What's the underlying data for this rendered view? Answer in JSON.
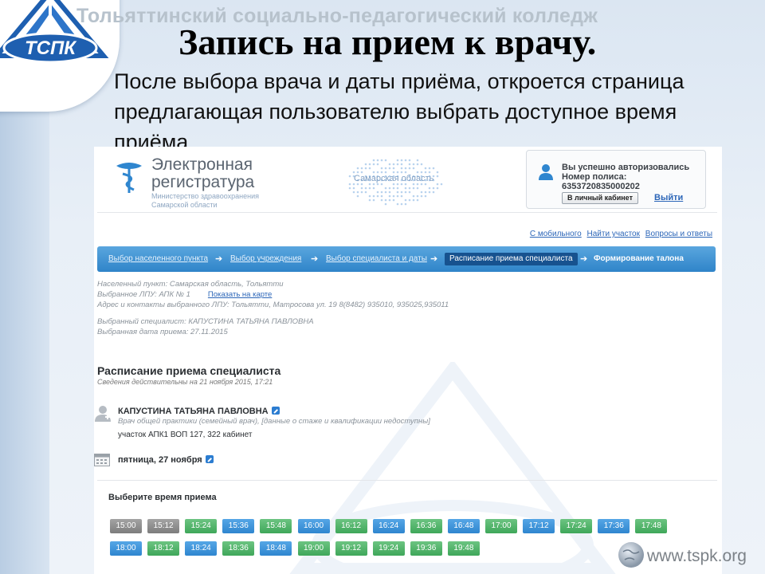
{
  "slide": {
    "college_name": "Тольяттинский социально-педагогический колледж",
    "logo_text": "ТСПК",
    "title": "Запись на прием к врачу.",
    "body": "После выбора врача и даты приёма, откроется страница предлагающая пользователю выбрать доступное время приёма",
    "footer_url": "www.tspk.org"
  },
  "site": {
    "name_line1": "Электронная",
    "name_line2": "регистратура",
    "ministry_line1": "Министерство здравоохранения",
    "ministry_line2": "Самарской области",
    "region": "Самарская область",
    "auth": {
      "status": "Вы успешно авторизовались",
      "policy_label": "Номер полиса:",
      "policy_number": "6353720835000202",
      "cabinet_button": "В личный кабинет",
      "logout": "Выйти"
    },
    "quick_links": [
      "С мобильного",
      "Найти участок",
      "Вопросы и ответы"
    ],
    "steps": [
      {
        "label": "Выбор населенного пункта",
        "state": "done"
      },
      {
        "label": "Выбор учреждения",
        "state": "done"
      },
      {
        "label": "Выбор специалиста и даты",
        "state": "done"
      },
      {
        "label": "Расписание приема специалиста",
        "state": "active"
      },
      {
        "label": "Формирование талона",
        "state": "next"
      }
    ],
    "info": {
      "settlement": "Населенный пункт: Самарская область, Тольятти",
      "lpu": "Выбранное ЛПУ: АПК № 1",
      "map_link": "Показать на карте",
      "address": "Адрес и контакты выбранного ЛПУ: Тольятти, Матросова ул. 19 8(8482) 935010, 935025,935011",
      "specialist": "Выбранный специалист: КАПУСТИНА ТАТЬЯНА ПАВЛОВНА",
      "date": "Выбранная дата приема: 27.11.2015"
    },
    "schedule": {
      "title": "Расписание приема специалиста",
      "subtitle": "Сведения действительны на 21 ноября 2015, 17:21",
      "doctor_name": "КАПУСТИНА ТАТЬЯНА ПАВЛОВНА",
      "doctor_spec": "Врач общей практики (семейный врач), [данные о стаже и квалификации недоступны]",
      "doctor_site": "участок АПК1 ВОП 127, 322 кабинет",
      "day": "пятница, 27 ноября",
      "pick_label": "Выберите время приема"
    },
    "slots_row1": [
      {
        "time": "15:00",
        "color": "busy"
      },
      {
        "time": "15:12",
        "color": "busy"
      },
      {
        "time": "15:24",
        "color": "green"
      },
      {
        "time": "15:36",
        "color": "blue"
      },
      {
        "time": "15:48",
        "color": "green"
      },
      {
        "time": "16:00",
        "color": "blue"
      },
      {
        "time": "16:12",
        "color": "green"
      },
      {
        "time": "16:24",
        "color": "blue"
      },
      {
        "time": "16:36",
        "color": "green"
      },
      {
        "time": "16:48",
        "color": "blue"
      },
      {
        "time": "17:00",
        "color": "green"
      },
      {
        "time": "17:12",
        "color": "blue"
      },
      {
        "time": "17:24",
        "color": "green"
      },
      {
        "time": "17:36",
        "color": "blue"
      },
      {
        "time": "17:48",
        "color": "green"
      }
    ],
    "slots_row2": [
      {
        "time": "18:00",
        "color": "blue"
      },
      {
        "time": "18:12",
        "color": "green"
      },
      {
        "time": "18:24",
        "color": "blue"
      },
      {
        "time": "18:36",
        "color": "green"
      },
      {
        "time": "18:48",
        "color": "blue"
      },
      {
        "time": "19:00",
        "color": "green"
      },
      {
        "time": "19:12",
        "color": "green"
      },
      {
        "time": "19:24",
        "color": "green"
      },
      {
        "time": "19:36",
        "color": "green"
      },
      {
        "time": "19:48",
        "color": "green"
      }
    ]
  }
}
